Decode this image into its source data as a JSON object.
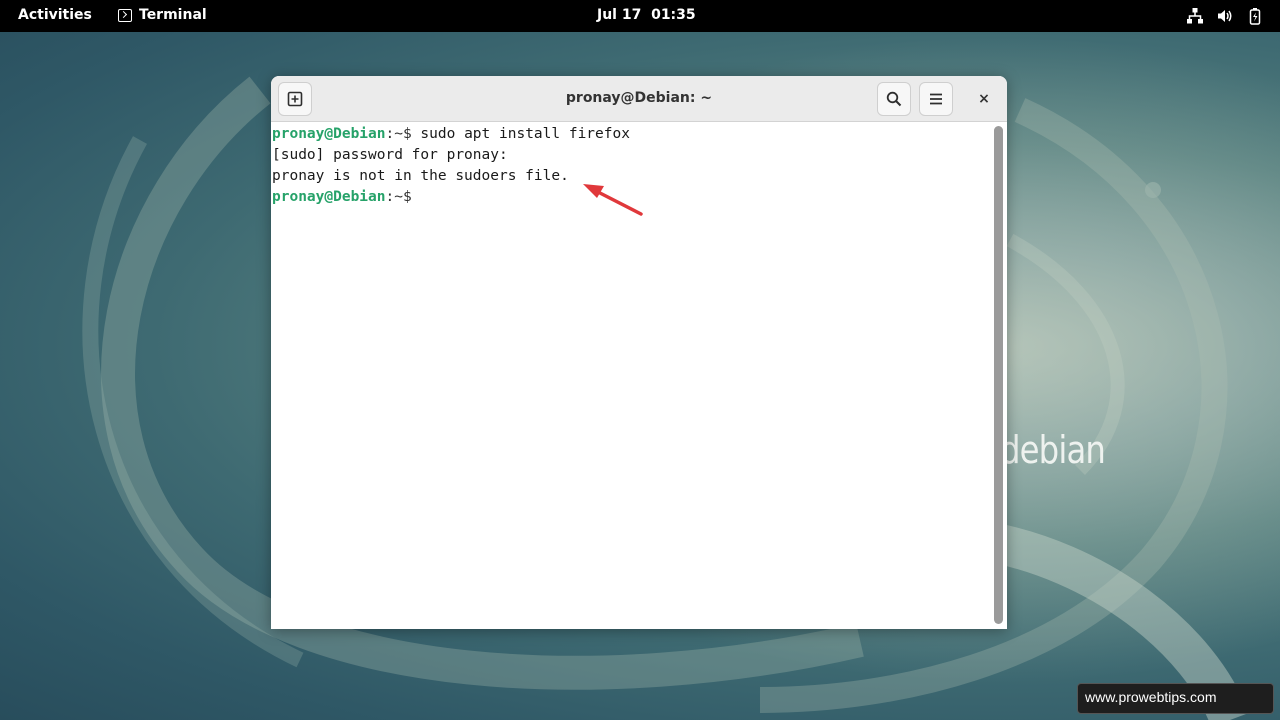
{
  "topbar": {
    "activities": "Activities",
    "app_name": "Terminal",
    "clock": "Jul 17  01:35",
    "tray_icons": [
      "network-icon",
      "volume-icon",
      "battery-icon"
    ]
  },
  "desktop": {
    "logo_text": "debian"
  },
  "window": {
    "title": "pronay@Debian: ~",
    "new_tab_icon": "new-tab-icon",
    "search_icon": "search-icon",
    "menu_icon": "hamburger-menu-icon",
    "close_label": "×"
  },
  "terminal": {
    "line1_user": "pronay@Debian",
    "line1_path": ":~$",
    "line1_cmd": " sudo apt install firefox",
    "line2": "[sudo] password for pronay:",
    "line3": "pronay is not in the sudoers file.",
    "line4_user": "pronay@Debian",
    "line4_path": ":~$"
  },
  "annotation": {
    "arrow_color": "#e0383b"
  },
  "watermark": {
    "text": "www.prowebtips.com"
  }
}
